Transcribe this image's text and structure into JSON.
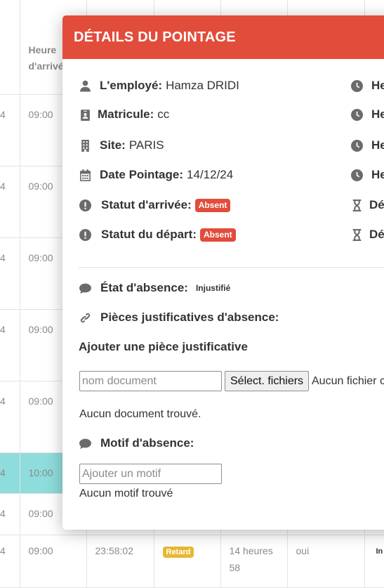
{
  "table": {
    "header": [
      "",
      "Heure d'arrivée",
      "",
      "",
      "",
      "",
      ""
    ],
    "rows": [
      {
        "c0": "4",
        "c1": "09:00"
      },
      {
        "c0": "4",
        "c1": "09:00"
      },
      {
        "c0": "4",
        "c1": "09:00"
      },
      {
        "c0": "4",
        "c1": "09:00"
      },
      {
        "c0": "4",
        "c1": "09:00"
      },
      {
        "c0": "4",
        "c1": "10:00"
      },
      {
        "c0": "4",
        "c1": "09:00"
      }
    ],
    "last_row": {
      "c0": "4",
      "c1": "09:00",
      "c2": "23:58:02",
      "badge": "Retard",
      "c4": "14 heures 58",
      "c5": "oui",
      "c6": "In"
    }
  },
  "modal": {
    "title": "DÉTAILS DU POINTAGE",
    "employee": {
      "label": "L'employé:",
      "value": "Hamza DRIDI"
    },
    "matricule": {
      "label": "Matricule:",
      "value": "cc"
    },
    "site": {
      "label": "Site:",
      "value": "PARIS"
    },
    "date": {
      "label": "Date Pointage:",
      "value": "14/12/24"
    },
    "statut_arrivee": {
      "label": "Statut d'arrivée:",
      "badge": "Absent"
    },
    "statut_depart": {
      "label": "Statut du départ:",
      "badge": "Absent"
    },
    "right_labels": [
      "He",
      "He",
      "He",
      "He",
      "Dé",
      "Dé"
    ],
    "etat_absence": {
      "label": "État d'absence:",
      "value": "Injustifié"
    },
    "pieces": {
      "label": "Pièces justificatives d'absence:"
    },
    "ajouter_piece": "Ajouter une pièce justificative",
    "doc_input": {
      "placeholder": "nom document"
    },
    "file_button": "Sélect. fichiers",
    "file_status": "Aucun fichier c",
    "no_document": "Aucun document trouvé.",
    "motif": {
      "label": "Motif d'absence:"
    },
    "motif_input": {
      "placeholder": "Ajouter un motif"
    },
    "no_motif": "Aucun motif trouvé"
  },
  "colors": {
    "header": "#e24c3b",
    "badge_absent": "#e24c3b",
    "badge_retard": "#e8b834",
    "highlight_row": "#8fdcdc"
  }
}
